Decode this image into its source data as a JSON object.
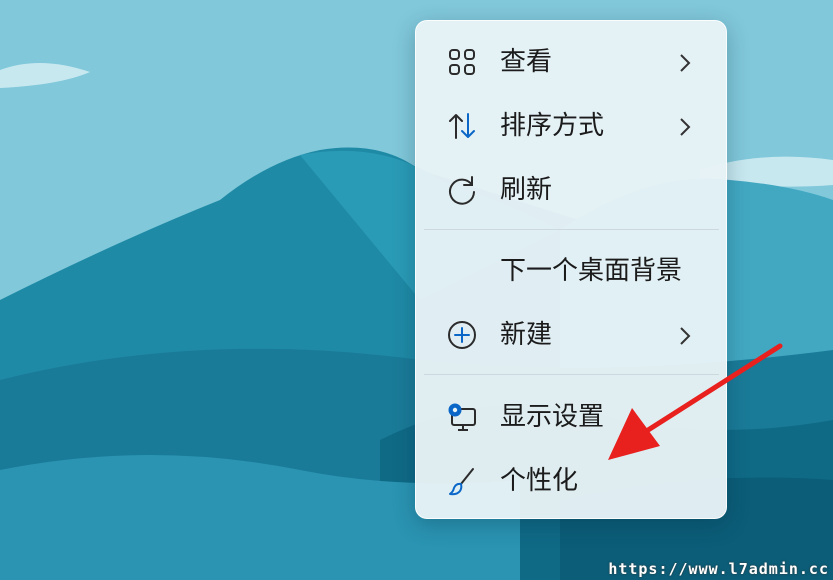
{
  "menu": {
    "items": [
      {
        "label": "查看",
        "icon": "grid-view-icon",
        "has_submenu": true
      },
      {
        "label": "排序方式",
        "icon": "sort-arrows-icon",
        "has_submenu": true
      },
      {
        "label": "刷新",
        "icon": "refresh-icon",
        "has_submenu": false
      },
      {
        "label": "下一个桌面背景",
        "icon": "",
        "has_submenu": false
      },
      {
        "label": "新建",
        "icon": "plus-circle-icon",
        "has_submenu": true
      },
      {
        "label": "显示设置",
        "icon": "display-settings-icon",
        "has_submenu": false
      },
      {
        "label": "个性化",
        "icon": "paintbrush-icon",
        "has_submenu": false
      }
    ]
  },
  "annotation": {
    "arrow_color": "#e8201e"
  },
  "watermark": {
    "text": "https://www.l7admin.cc"
  },
  "colors": {
    "accent": "#0a67c8",
    "menu_bg": "#e8f3f6",
    "sky": "#7cc4d6"
  }
}
